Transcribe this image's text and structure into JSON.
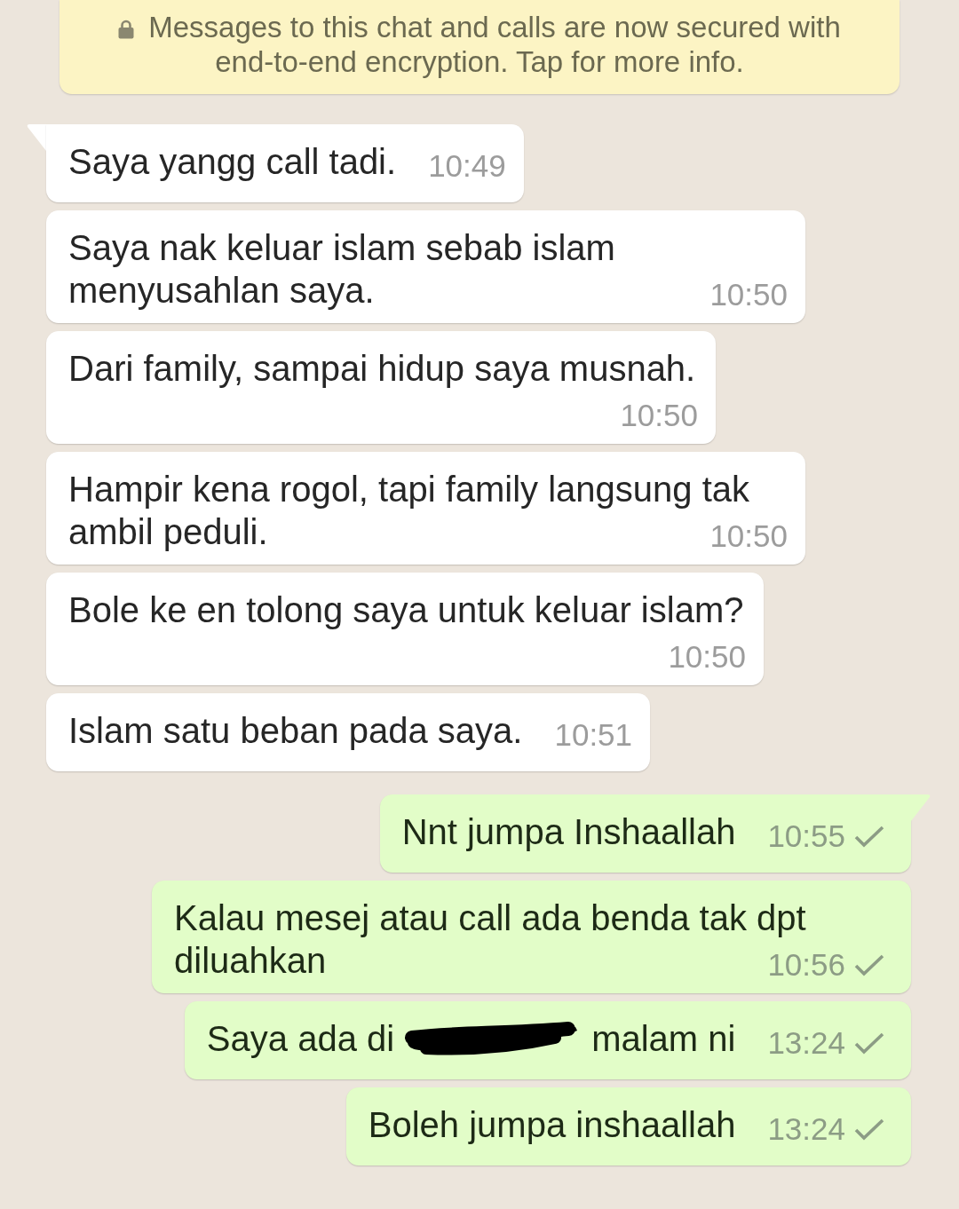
{
  "encryption_notice": {
    "text": "Messages to this chat and calls are now secured with end-to-end encryption. Tap for more info."
  },
  "messages": [
    {
      "kind": "incoming",
      "tail": true,
      "redacted": false,
      "text": "Saya yangg call tadi.",
      "time": "10:49"
    },
    {
      "kind": "incoming",
      "tail": false,
      "redacted": false,
      "text": "Saya nak keluar islam sebab islam menyusahlan saya.",
      "time": "10:50"
    },
    {
      "kind": "incoming",
      "tail": false,
      "redacted": false,
      "text": "Dari family, sampai hidup saya musnah.",
      "time": "10:50"
    },
    {
      "kind": "incoming",
      "tail": false,
      "redacted": false,
      "text": "Hampir kena rogol, tapi family langsung tak ambil peduli.",
      "time": "10:50"
    },
    {
      "kind": "incoming",
      "tail": false,
      "redacted": false,
      "text": "Bole ke en tolong saya untuk keluar islam?",
      "time": "10:50"
    },
    {
      "kind": "incoming",
      "tail": false,
      "redacted": false,
      "text": "Islam satu beban pada saya.",
      "time": "10:51"
    },
    {
      "kind": "outgoing",
      "tail": true,
      "redacted": false,
      "text": "Nnt jumpa Inshaallah",
      "time": "10:55",
      "delivered": false
    },
    {
      "kind": "outgoing",
      "tail": false,
      "redacted": false,
      "text": "Kalau mesej atau call ada benda tak dpt diluahkan",
      "time": "10:56",
      "delivered": false
    },
    {
      "kind": "outgoing",
      "tail": false,
      "redacted": true,
      "text": "Saya ada di",
      "text_after": "malam ni",
      "time": "13:24",
      "delivered": false
    },
    {
      "kind": "outgoing",
      "tail": false,
      "redacted": false,
      "text": "Boleh jumpa inshaallah",
      "time": "13:24",
      "delivered": false
    }
  ]
}
